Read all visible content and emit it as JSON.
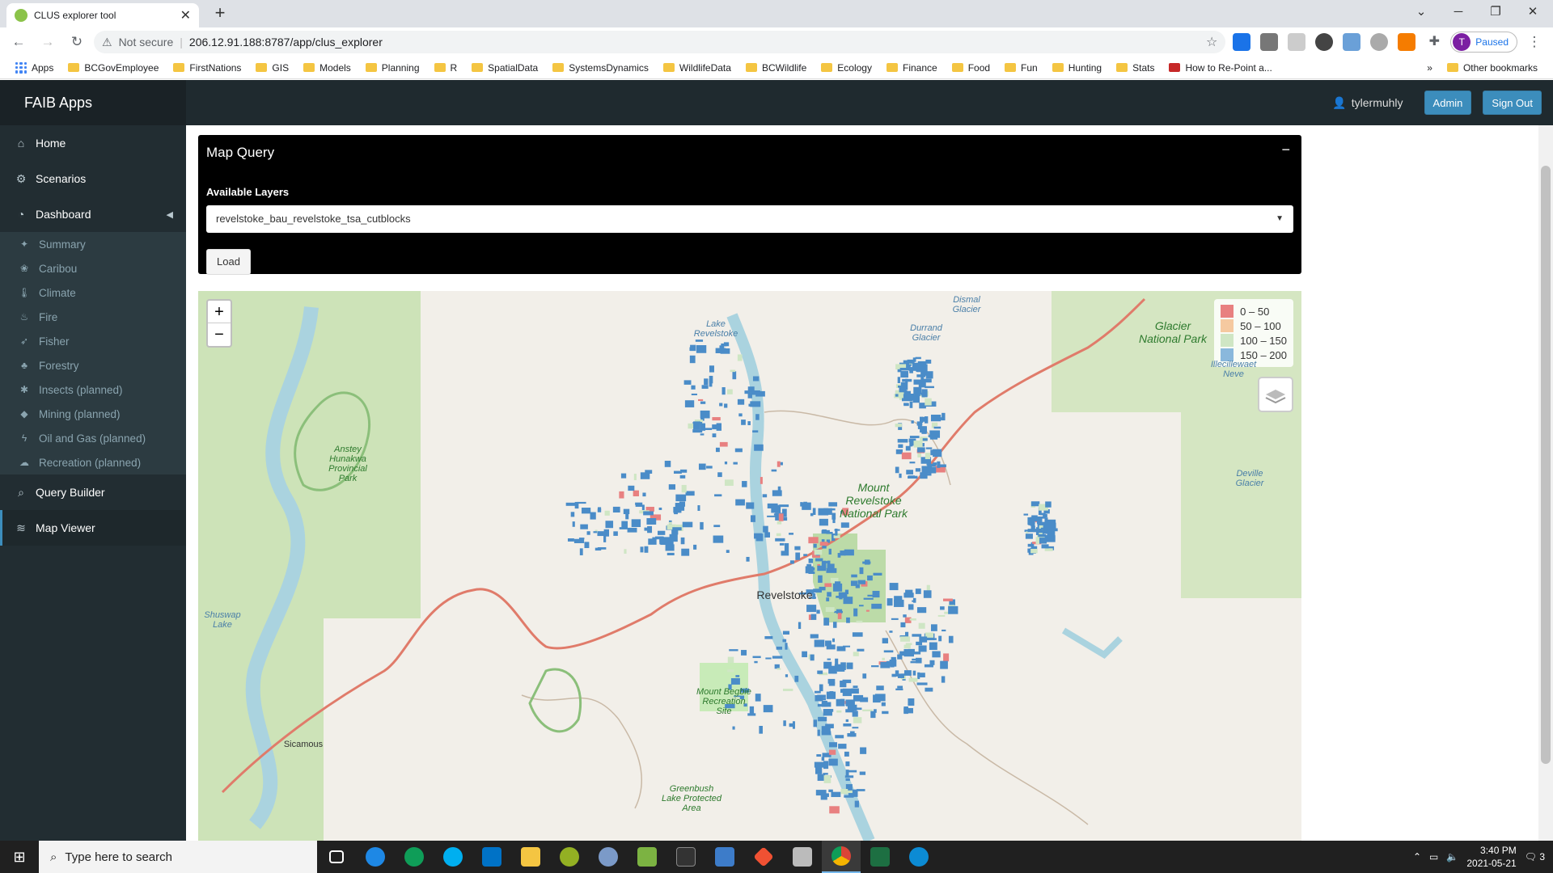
{
  "browser": {
    "tab_title": "CLUS explorer tool",
    "url_warning": "Not secure",
    "url": "206.12.91.188:8787/app/clus_explorer",
    "profile_initial": "T",
    "profile_status": "Paused",
    "bookmarks": [
      "Apps",
      "BCGovEmployee",
      "FirstNations",
      "GIS",
      "Models",
      "Planning",
      "R",
      "SpatialData",
      "SystemsDynamics",
      "WildlifeData",
      "BCWildlife",
      "Ecology",
      "Finance",
      "Food",
      "Fun",
      "Hunting",
      "Stats",
      "How to Re-Point a..."
    ],
    "other_bookmarks": "Other bookmarks",
    "overflow": "»"
  },
  "header": {
    "brand": "FAIB Apps",
    "user": "tylermuhly",
    "admin": "Admin",
    "signout": "Sign Out"
  },
  "sidebar": {
    "home": "Home",
    "scenarios": "Scenarios",
    "dashboard": "Dashboard",
    "sub": [
      "Summary",
      "Caribou",
      "Climate",
      "Fire",
      "Fisher",
      "Forestry",
      "Insects (planned)",
      "Mining (planned)",
      "Oil and Gas (planned)",
      "Recreation (planned)"
    ],
    "query_builder": "Query Builder",
    "map_viewer": "Map Viewer"
  },
  "panel": {
    "title": "Map Query",
    "minimize": "−",
    "label": "Available Layers",
    "selected": "revelstoke_bau_revelstoke_tsa_cutblocks",
    "load": "Load"
  },
  "map": {
    "zoom_in": "+",
    "zoom_out": "−",
    "legend": [
      {
        "label": "0 – 50",
        "color": "#e88080"
      },
      {
        "label": "50 – 100",
        "color": "#f5c9a0"
      },
      {
        "label": "100 – 150",
        "color": "#cfe6c4"
      },
      {
        "label": "150 – 200",
        "color": "#8ab8dc"
      }
    ],
    "labels": {
      "glacier_np": "Glacier National Park",
      "dismal": "Dismal Glacier",
      "durrand": "Durrand Glacier",
      "lake_revelstoke": "Lake Revelstoke",
      "illecillewaet": "Illecillewaet Neve",
      "deville": "Deville Glacier",
      "anstey": "Anstey Hunakwa Provincial Park",
      "mt_revelstoke": "Mount Revelstoke National Park",
      "revelstoke": "Revelstoke",
      "shuswap": "Shuswap Lake",
      "begbie": "Mount Begbie Recreation Site",
      "sicamous": "Sicamous",
      "greenbush": "Greenbush Lake Protected Area"
    },
    "cutblock_color": "#4a8cc8"
  },
  "taskbar": {
    "search_placeholder": "Type here to search",
    "time": "3:40 PM",
    "date": "2021-05-21",
    "notif_count": "3"
  }
}
